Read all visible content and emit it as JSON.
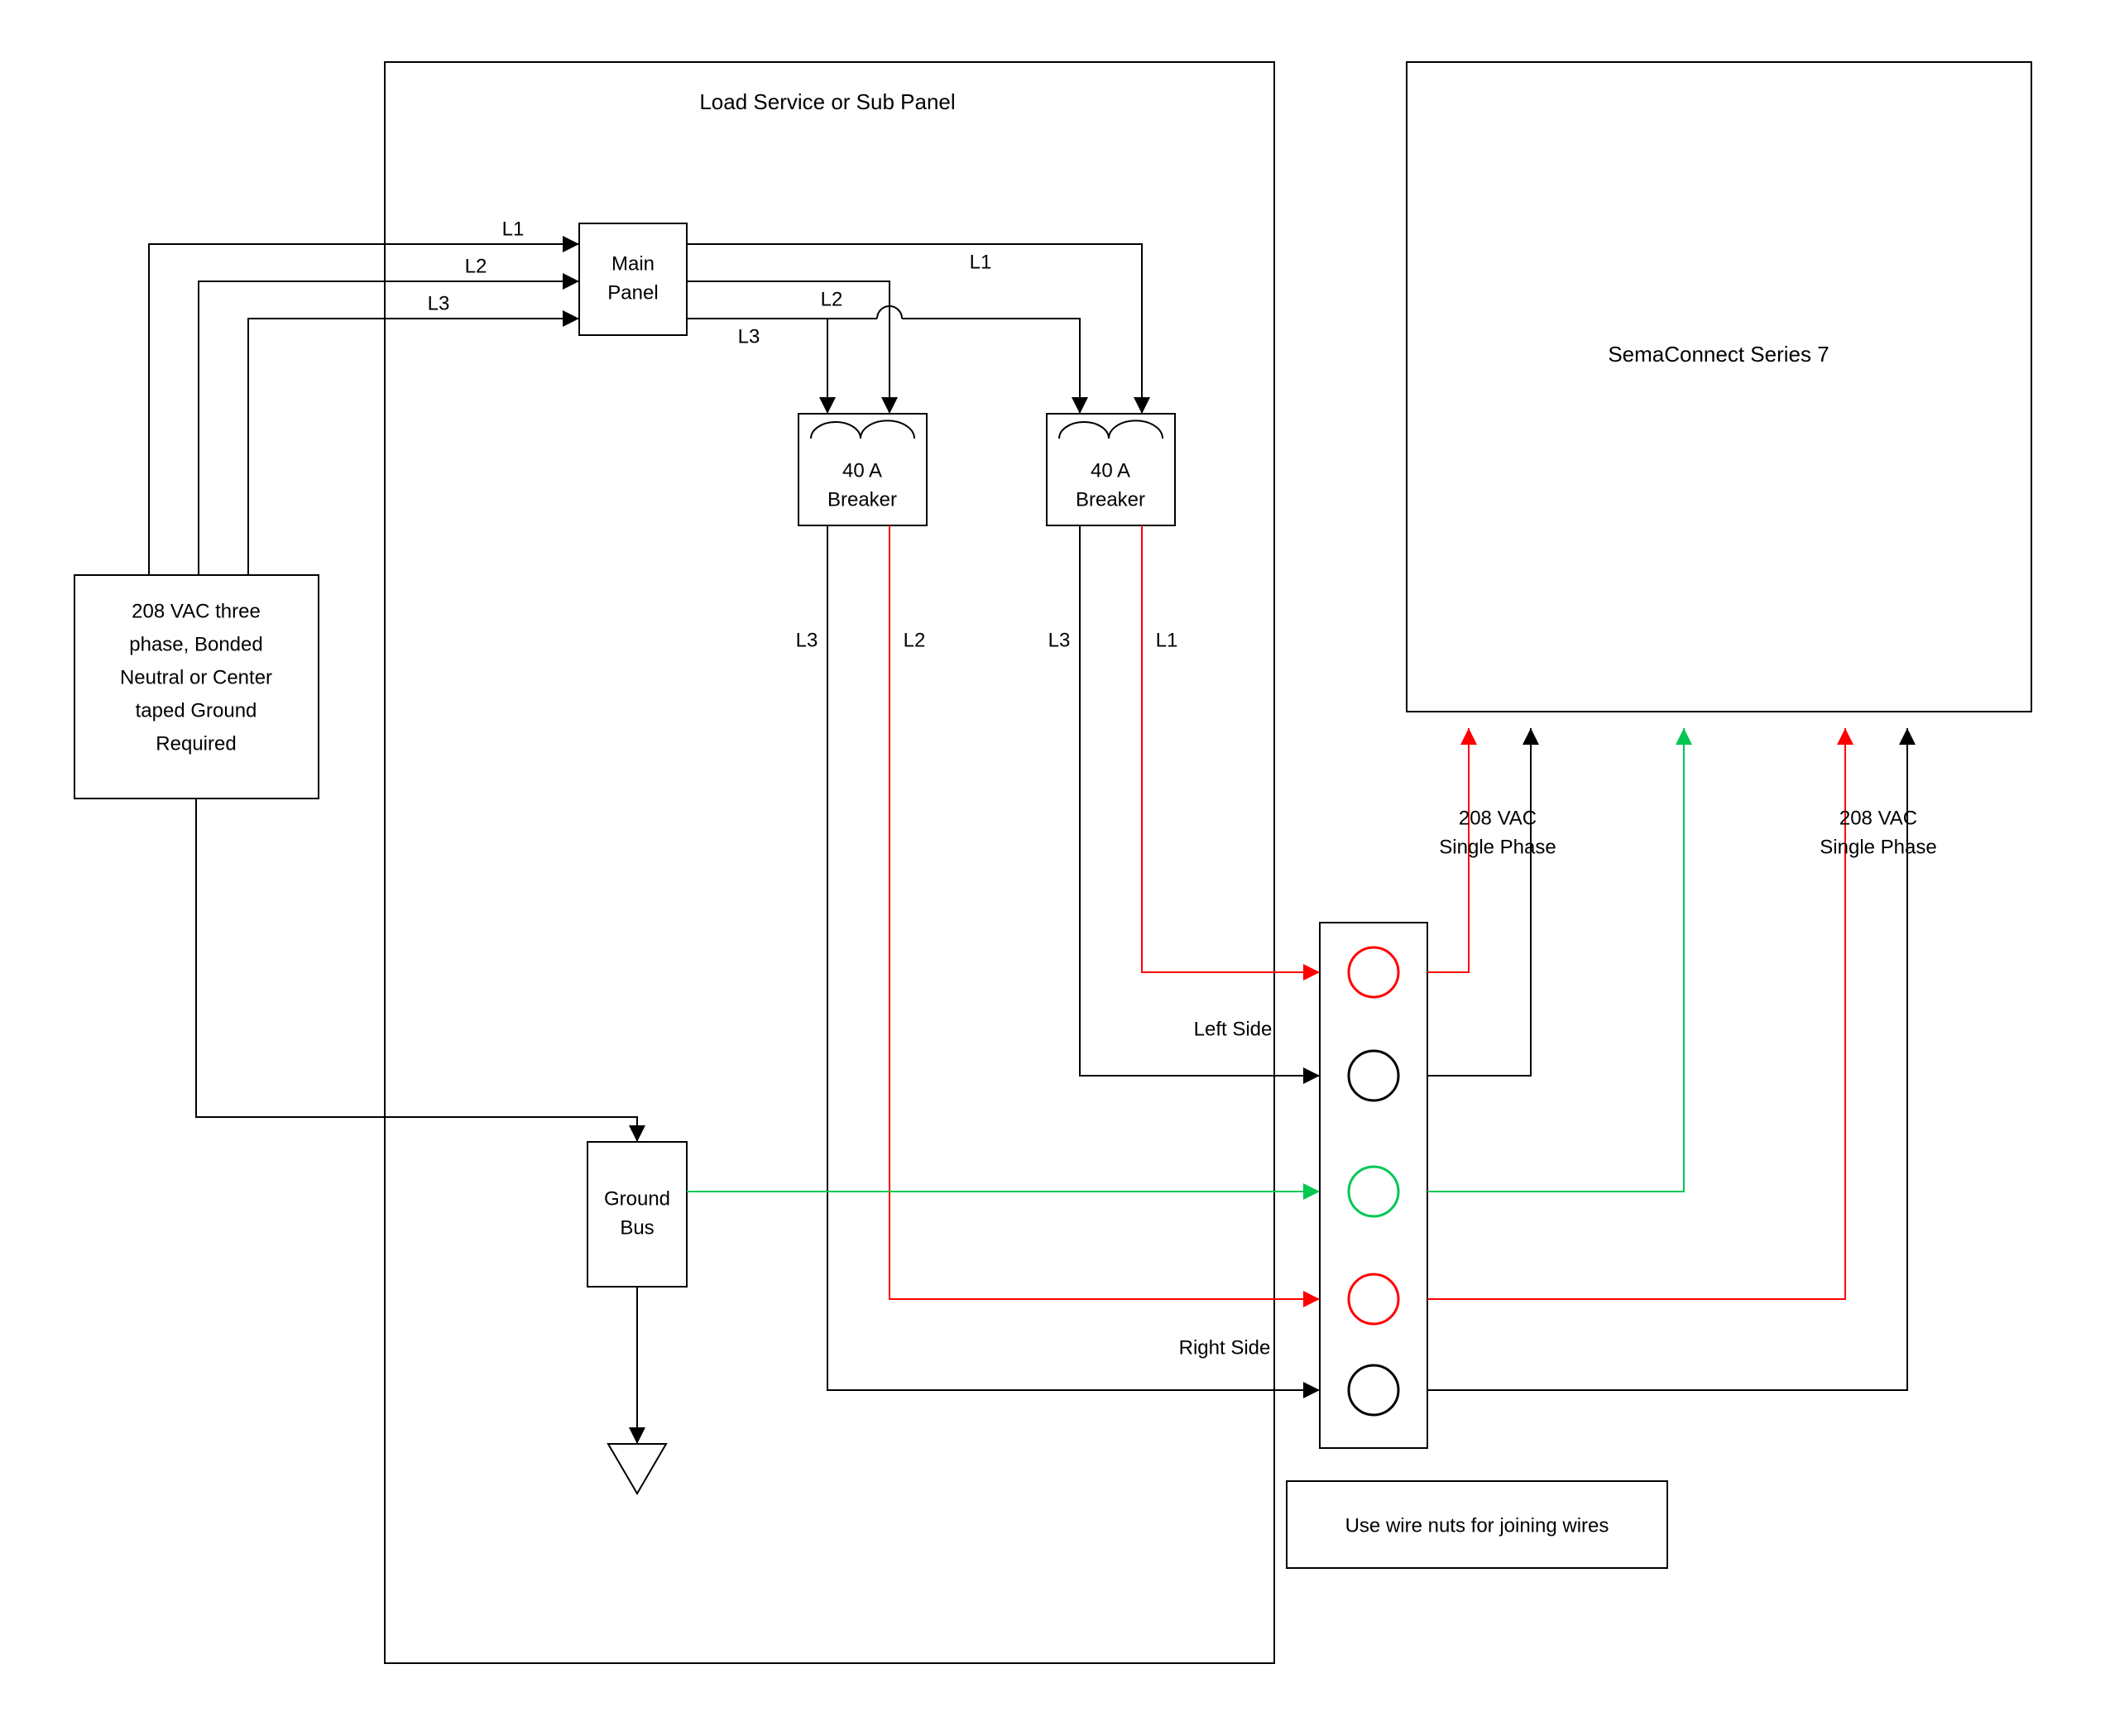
{
  "diagram": {
    "panel_title": "Load Service or Sub Panel",
    "source_box": {
      "l1": "208 VAC three",
      "l2": "phase, Bonded",
      "l3": "Neutral or Center",
      "l4": "taped Ground",
      "l5": "Required"
    },
    "main_panel": {
      "l1": "Main",
      "l2": "Panel"
    },
    "breaker_left": {
      "l1": "40 A",
      "l2": "Breaker"
    },
    "breaker_right": {
      "l1": "40 A",
      "l2": "Breaker"
    },
    "ground_bus": {
      "l1": "Ground",
      "l2": "Bus"
    },
    "sema": "SemaConnect Series 7",
    "wire_nuts": "Use wire nuts for joining wires",
    "phase": {
      "L1": "L1",
      "L2": "L2",
      "L3": "L3"
    },
    "side": {
      "left": "Left Side",
      "right": "Right Side"
    },
    "vac_label": {
      "l1": "208 VAC",
      "l2": "Single Phase"
    }
  }
}
